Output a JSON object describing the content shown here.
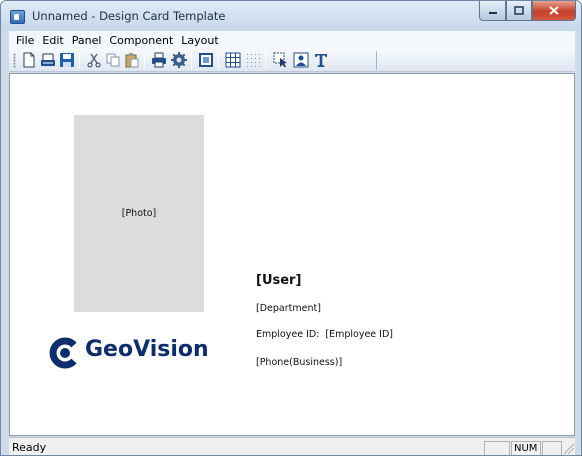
{
  "window": {
    "title": "Unnamed - Design Card Template"
  },
  "menu": [
    "File",
    "Edit",
    "Panel",
    "Component",
    "Layout"
  ],
  "toolbar": {
    "icons": [
      "new-icon",
      "open-icon",
      "save-icon",
      "cut-icon",
      "copy-icon",
      "paste-icon",
      "print-icon",
      "settings-icon",
      "background-icon",
      "grid-icon",
      "dotted-grid-icon",
      "select-icon",
      "photo-tool-icon",
      "text-tool-icon"
    ]
  },
  "card": {
    "photo_placeholder": "[Photo]",
    "user": "[User]",
    "department": "[Department]",
    "employee_id_label": "Employee ID:",
    "employee_id_value": "[Employee ID]",
    "phone": "[Phone(Business)]",
    "logo_text": "GeoVision",
    "brand_color": "#0d2d6f"
  },
  "status": {
    "text": "Ready",
    "num": "NUM"
  }
}
